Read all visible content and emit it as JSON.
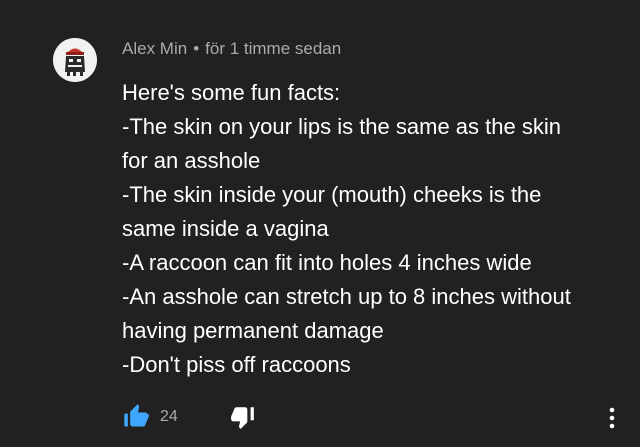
{
  "comment": {
    "author": "Alex Min",
    "separator": "•",
    "timestamp": "för 1 timme sedan",
    "lines": [
      "Here's some fun facts:",
      "-The skin on your lips is the same as the skin",
      "for an asshole",
      "-The skin inside your (mouth) cheeks is the",
      "same inside a vagina",
      "-A raccoon can fit into holes 4 inches wide",
      "-An asshole can stretch up to 8 inches without",
      "having permanent damage",
      "-Don't piss off raccoons"
    ],
    "like_count": "24"
  },
  "icons": {
    "like": "thumbs-up-icon",
    "dislike": "thumbs-down-icon",
    "more": "more-vertical-icon",
    "avatar": "avatar-image"
  },
  "colors": {
    "background": "#212121",
    "text_primary": "#ffffff",
    "text_secondary": "#aaaaaa",
    "like_active": "#3ea6ff"
  }
}
